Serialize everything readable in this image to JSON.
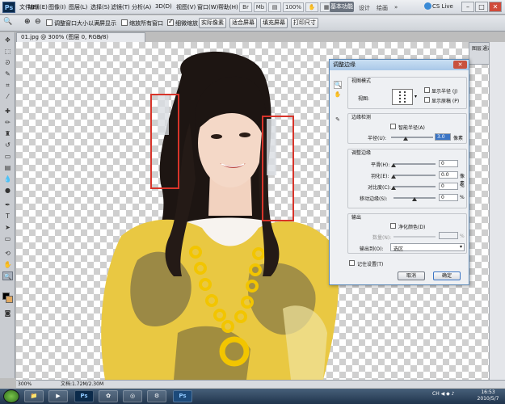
{
  "app": {
    "logo": "Ps"
  },
  "menu": [
    "文件(F)",
    "编辑(E)",
    "图像(I)",
    "图层(L)",
    "选择(S)",
    "滤镜(T)",
    "分析(A)",
    "3D(D)",
    "视图(V)",
    "窗口(W)",
    "帮助(H)"
  ],
  "bridge": {
    "zoom": "100%",
    "labels": [
      "Br",
      "Mb",
      "▤",
      "✋",
      "⊕",
      "▦",
      "▾"
    ]
  },
  "workspaces": {
    "active": "基本功能",
    "others": [
      "设计",
      "绘画",
      "»"
    ]
  },
  "cslive": "CS Live",
  "window_controls": [
    "–",
    "□",
    "✕"
  ],
  "options": {
    "resize_windows": "调整窗口大小以满屏显示",
    "zoom_all": "缩放所有窗口",
    "scrubby_zoom": "细微缩放",
    "actual_pixels": "实际像素",
    "fit_screen": "适合屏幕",
    "fill_screen": "填充屏幕",
    "print_size": "打印尺寸"
  },
  "document": {
    "tab_title": "01.jpg @ 300% (图层 0, RGB/8)",
    "zoom": "300%",
    "doc_info": "文档:1.72M/2.30M"
  },
  "panel_tabs": [
    "图层",
    "通道",
    "路径"
  ],
  "dialog": {
    "title": "调整边缘",
    "view_mode": {
      "group": "视图模式",
      "view_label": "视图:",
      "show_radius": "显示半径 (J)",
      "show_original": "显示原稿 (P)"
    },
    "edge_detection": {
      "group": "边缘检测",
      "smart_radius": "智能半径(A)",
      "radius_label": "半径(U):",
      "radius_value": "3.0",
      "radius_unit": "像素",
      "radius_level": 0.35
    },
    "adjust_edge": {
      "group": "调整边缘",
      "rows": [
        {
          "label": "平滑(H):",
          "value": "0",
          "unit": ""
        },
        {
          "label": "羽化(E):",
          "value": "0.0",
          "unit": "像素"
        },
        {
          "label": "对比度(C):",
          "value": "0",
          "unit": "%"
        },
        {
          "label": "移动边缘(S):",
          "value": "0",
          "unit": "%"
        }
      ]
    },
    "output": {
      "group": "输出",
      "decontaminate": "净化颜色(D)",
      "amount_label": "数量(N):",
      "amount_unit": "%",
      "output_to_label": "输出到(O):",
      "output_to_value": "选区"
    },
    "remember": "记住设置(T)",
    "cancel": "取消",
    "ok": "确定"
  },
  "taskbar": {
    "apps": [
      "📁",
      "▶",
      "Ps",
      "✿",
      "◎",
      "⚙",
      "Ps"
    ],
    "tray": "CH ◀ ◆ ♪",
    "time": "16:53",
    "date": "2010/5/7"
  },
  "colors": {
    "accent": "#6c7480",
    "highlight_box": "#d8342a",
    "scarf": "#e9c842"
  }
}
